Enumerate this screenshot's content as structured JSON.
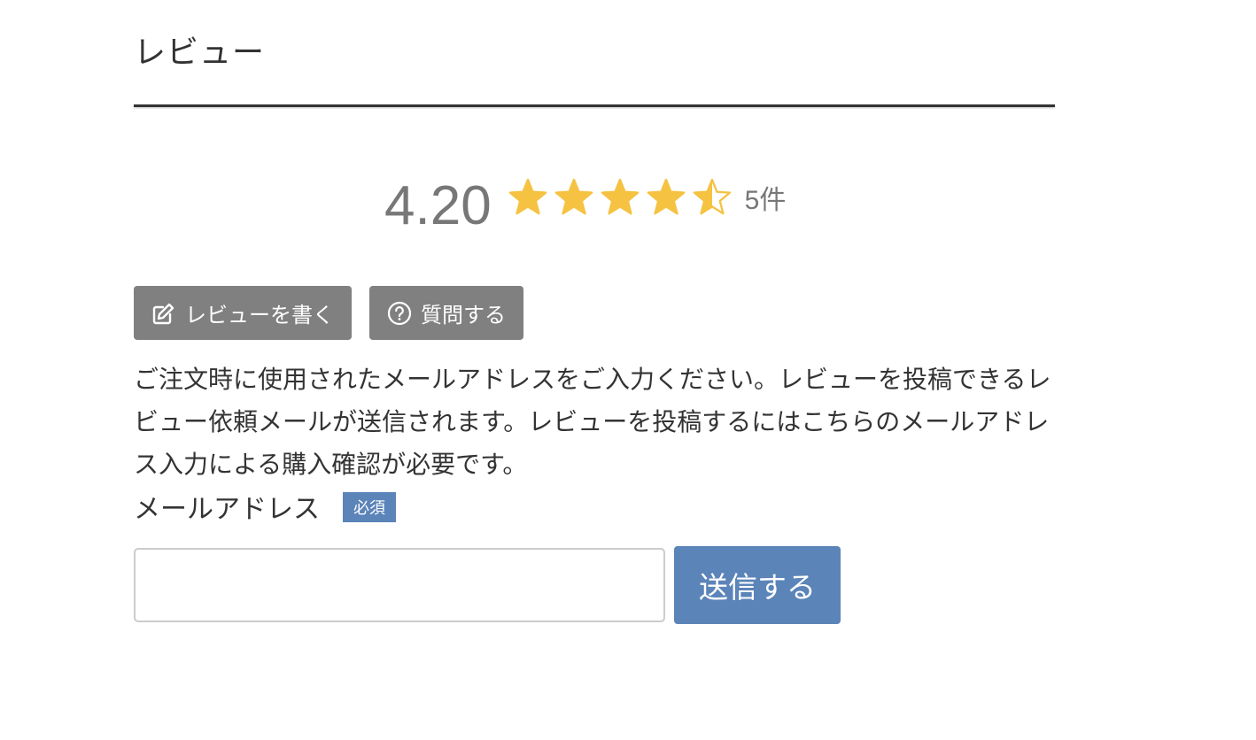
{
  "section": {
    "title": "レビュー"
  },
  "rating": {
    "average": "4.20",
    "value": 4.2,
    "max": 5,
    "count_label": "5件",
    "star_color": "#f5c242"
  },
  "actions": {
    "write_review_label": "レビューを書く",
    "write_review_icon": "edit-icon",
    "ask_question_label": "質問する",
    "ask_question_icon": "question-circle-icon"
  },
  "description": "ご注文時に使用されたメールアドレスをご入力ください。レビューを投稿できるレビュー依頼メールが送信されます。レビューを投稿するにはこちらのメールアドレス入力による購入確認が必要です。",
  "form": {
    "email_label": "メールアドレス",
    "required_badge": "必須",
    "email_value": "",
    "email_placeholder": "",
    "submit_label": "送信する"
  },
  "colors": {
    "gray_button": "#808080",
    "accent_blue": "#5b84b9",
    "text": "#333333",
    "muted_text": "#777777"
  }
}
